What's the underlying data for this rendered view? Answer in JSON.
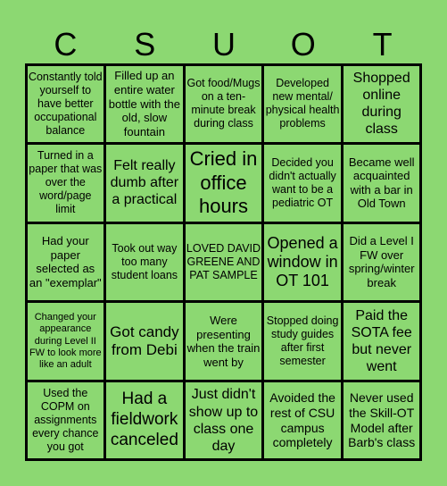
{
  "header": {
    "letters": [
      "C",
      "S",
      "U",
      "O",
      "T"
    ]
  },
  "board": {
    "cells": [
      [
        "Constantly told yourself to have better occupational balance",
        "Filled up an entire water bottle with the old, slow fountain",
        "Got food/Mugs on a ten-minute break during class",
        "Developed new mental/ physical health problems",
        "Shopped online during class"
      ],
      [
        "Turned in a paper that was over the word/page limit",
        "Felt really dumb after a practical",
        "Cried in office hours",
        "Decided you didn't actually want to be a pediatric OT",
        "Became well acquainted with a bar in Old Town"
      ],
      [
        "Had your paper selected as an \"exemplar\"",
        "Took out way too many student loans",
        "LOVED DAVID GREENE AND PAT SAMPLE",
        "Opened a window in OT 101",
        "Did a Level I FW over spring/winter break"
      ],
      [
        "Changed your appearance during Level II FW to look more like an adult",
        "Got candy from Debi",
        "Were presenting when the train went by",
        "Stopped doing study guides after first semester",
        "Paid the SOTA fee but never went"
      ],
      [
        "Used the COPM on assignments every chance you got",
        "Had a fieldwork canceled",
        "Just didn't show up to class one day",
        "Avoided the rest of CSU campus completely",
        "Never used the Skill-OT Model after Barb's class"
      ]
    ]
  },
  "colors": {
    "background": "#8cd872",
    "border": "#000000",
    "text": "#000000"
  }
}
